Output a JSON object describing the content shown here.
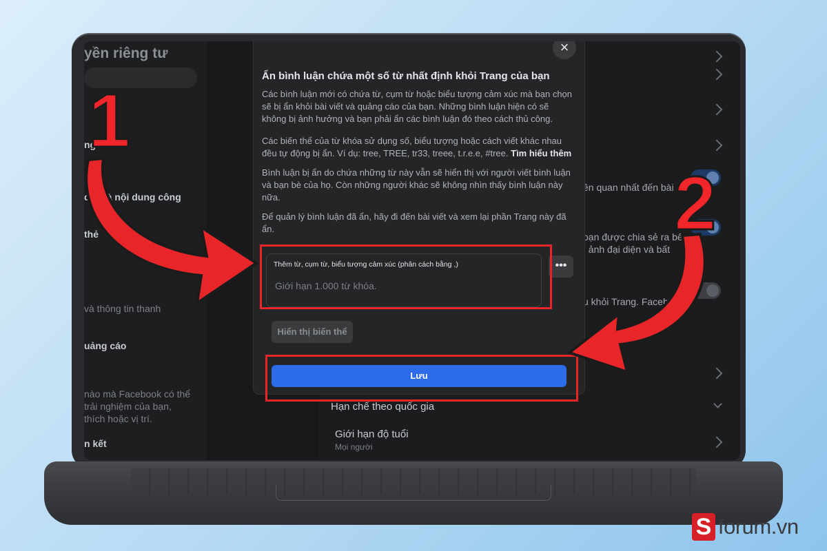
{
  "background_page": {
    "left_title": "yền riêng tư",
    "left_items": [
      {
        "label": "ng"
      },
      {
        "label": "dõi và nội dung công"
      },
      {
        "label": "thẻ"
      },
      {
        "label": "và thông tin thanh"
      },
      {
        "label": "uảng cáo"
      },
      {
        "label": "nào mà Facebook có thể"
      },
      {
        "label": "trải nghiệm của bạn,"
      },
      {
        "label": "thích hoặc vị trí."
      },
      {
        "label": "n kết"
      }
    ],
    "right_items": [
      {
        "label": "ên quan nhất đến bài"
      },
      {
        "label": "oạn được chia sẻ ra bên"
      },
      {
        "label": ", ảnh đại diện và bất"
      },
      {
        "label": "u khỏi Trang. Facebo"
      },
      {
        "label": "Hạn chế theo quốc gia"
      },
      {
        "label": "Giới hạn độ tuổi"
      },
      {
        "label": "Mọi người"
      }
    ]
  },
  "dialog": {
    "title": "Ẩn bình luận chứa một số từ nhất định khỏi Trang của bạn",
    "para1": "Các bình luận mới có chứa từ, cụm từ hoặc biểu tượng cảm xúc mà bạn chọn sẽ bị ẩn khỏi bài viết và quảng cáo của bạn. Những bình luận hiện có sẽ không bị ảnh hưởng và bạn phải ẩn các bình luận đó theo cách thủ công.",
    "para2": "Các biến thể của từ khóa sử dụng số, biểu tượng hoặc cách viết khác nhau đều tự động bị ẩn. Ví dụ: tree, TREE, tr33, treee, t.r.e.e, #tree.",
    "learn_more": "Tìm hiểu thêm",
    "para3": "Bình luận bị ẩn do chứa những từ này vẫn sẽ hiển thị với người viết bình luận và bạn bè của họ. Còn những người khác sẽ không nhìn thấy bình luận này nữa.",
    "para4": "Để quản lý bình luận đã ẩn, hãy đi đến bài viết và xem lại phần Trang này đã ẩn.",
    "input_label": "Thêm từ, cụm từ, biểu tượng cảm xúc (phân cách bằng ,)",
    "input_placeholder": "Giới hạn 1.000 từ khóa.",
    "input_value": "",
    "more_label": "•••",
    "variant_button": "Hiển thị biến thể",
    "save_button": "Lưu",
    "close_label": "×"
  },
  "annotations": {
    "step1": "1",
    "step2": "2"
  },
  "logo": {
    "mark": "S",
    "text": "forum.vn"
  },
  "colors": {
    "highlight": "#e8262a",
    "save_button": "#2d6ce8",
    "dialog_bg": "#242526"
  }
}
